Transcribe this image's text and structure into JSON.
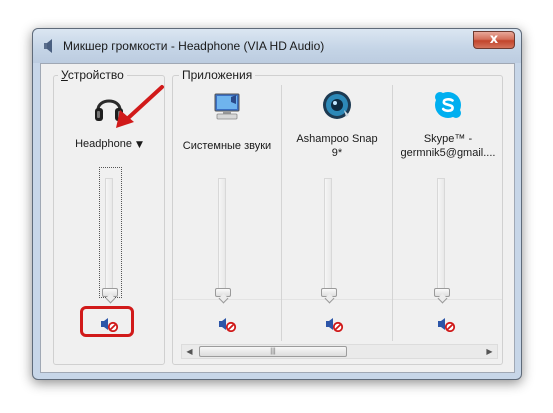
{
  "window": {
    "title": "Микшер громкости - Headphone (VIA HD Audio)",
    "close_glyph": "x"
  },
  "device_group": {
    "label_accel": "У",
    "label_rest": "стройство",
    "device_name": "Headphone",
    "dropdown_glyph": "▼",
    "icon": "headphones-icon",
    "volume_level": 0,
    "muted": true
  },
  "apps_group": {
    "label": "Приложения",
    "channels": [
      {
        "name": "Системные звуки",
        "icon": "system-sounds-icon",
        "volume_level": 0,
        "muted": true
      },
      {
        "name": "Ashampoo Snap 9*",
        "name_line1": "Ashampoo Snap",
        "name_line2": "9*",
        "icon": "ashampoo-snap-icon",
        "volume_level": 0,
        "muted": true
      },
      {
        "name": "Skype™ - germnik5@gmail....",
        "name_line1": "Skype™ -",
        "name_line2": "germnik5@gmail....",
        "icon": "skype-icon",
        "volume_level": 0,
        "muted": true
      }
    ]
  },
  "scrollbar": {
    "left_glyph": "◀",
    "right_glyph": "▶",
    "grip": "|||"
  },
  "colors": {
    "annotation_red": "#d11a1a",
    "skype_blue": "#00aff0"
  }
}
